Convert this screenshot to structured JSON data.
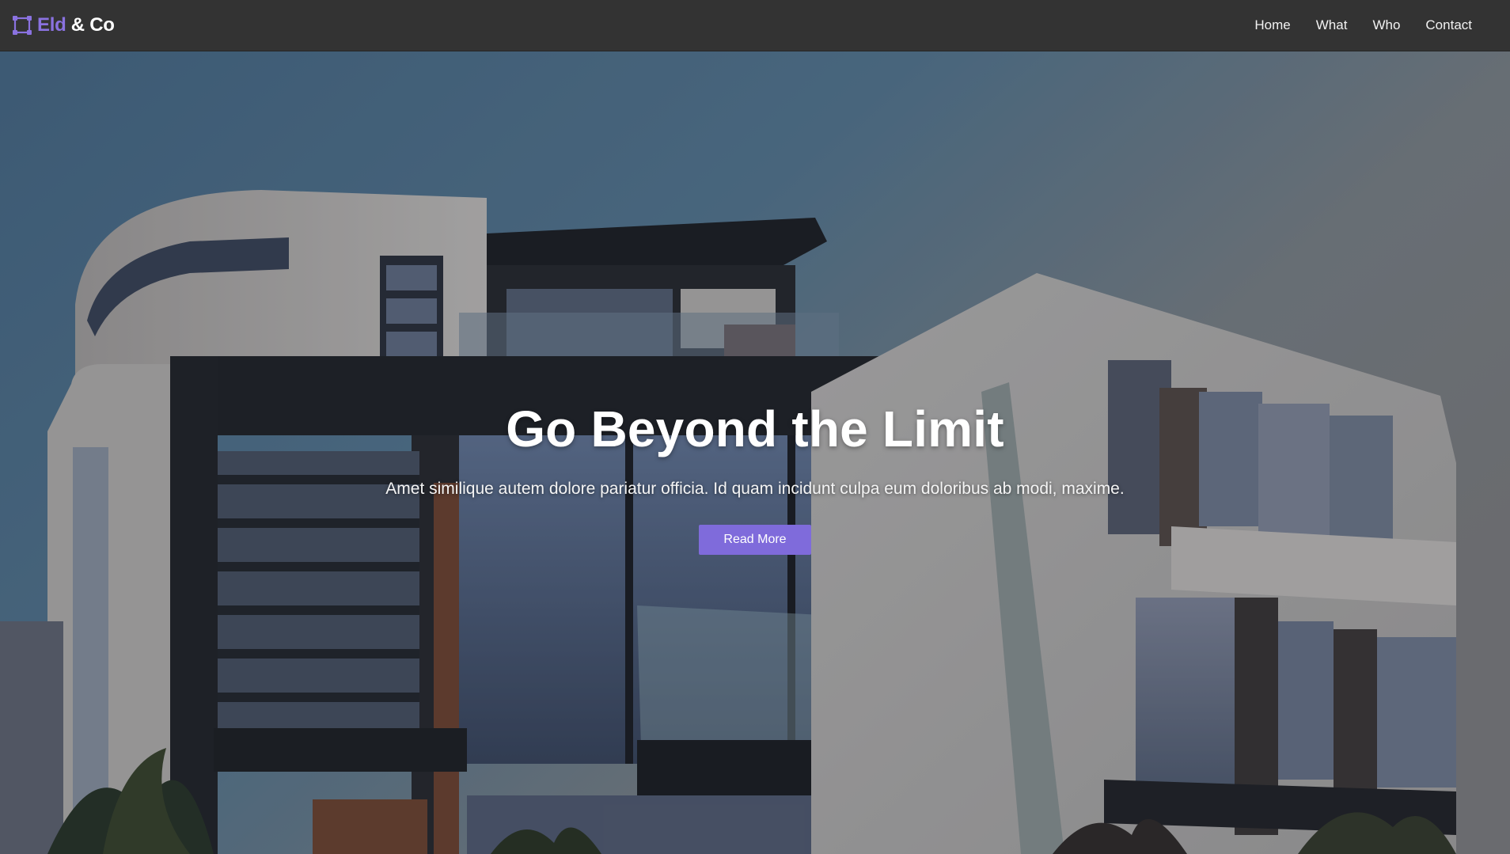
{
  "navbar": {
    "brand": {
      "accent": "Eld",
      "rest": " & Co",
      "icon": "vector-square-icon"
    },
    "links": [
      {
        "label": "Home"
      },
      {
        "label": "What"
      },
      {
        "label": "Who"
      },
      {
        "label": "Contact"
      }
    ]
  },
  "hero": {
    "title": "Go Beyond the Limit",
    "subtitle": "Amet similique autem dolore pariatur officia. Id quam incidunt culpa eum doloribus ab modi, maxime.",
    "cta_label": "Read More",
    "background": "modern-house-photo"
  },
  "colors": {
    "navbar_bg": "#333333",
    "accent": "#7f6bdb",
    "text": "#ffffff"
  }
}
